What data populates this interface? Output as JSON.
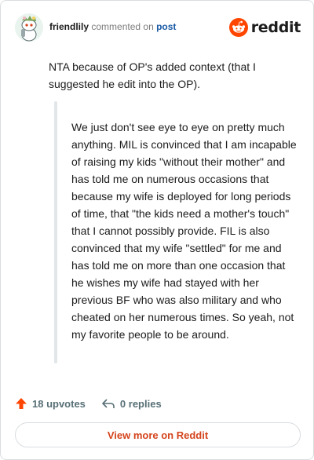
{
  "header": {
    "username": "friendlily",
    "action_text": "commented on",
    "post_link": "post",
    "brand_name": "reddit"
  },
  "comment": {
    "text": "NTA because of OP's added context (that I suggested he edit into the OP).",
    "quote": "We just don't see eye to eye on pretty much anything. MIL is convinced that I am incapable of raising my kids \"without their mother\" and has told me on numerous occasions that because my wife is deployed for long periods of time, that \"the kids need a mother's touch\" that I cannot possibly provide. FIL is also convinced that my wife \"settled\" for me and has told me on more than one occasion that he wishes my wife had stayed with her previous BF who was also military and who cheated on her numerous times. So yeah, not my favorite people to be around."
  },
  "actions": {
    "upvotes": "18 upvotes",
    "replies": "0 replies"
  },
  "footer": {
    "view_more": "View more on Reddit"
  },
  "colors": {
    "accent": "#d4441c",
    "upvote": "#ff4500",
    "link": "#1a5aa6",
    "muted": "#576f76"
  },
  "icons": {
    "avatar": "snoo-avatar-icon",
    "brand": "reddit-snoo-icon",
    "upvote": "upvote-arrow-icon",
    "reply": "reply-arrow-icon"
  }
}
